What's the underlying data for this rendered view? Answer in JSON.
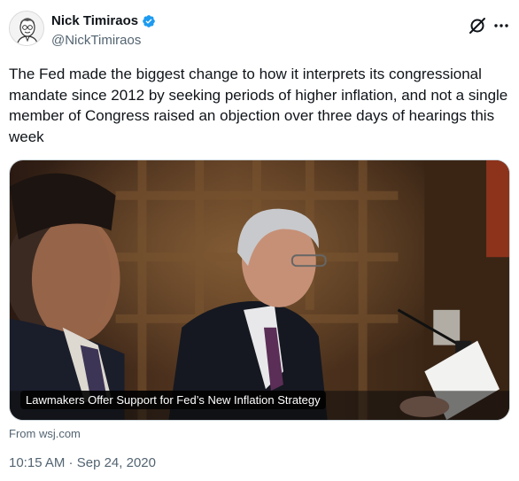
{
  "author": {
    "display_name": "Nick Timiraos",
    "handle": "@NickTimiraos",
    "verified": true
  },
  "tweet": {
    "text": "The Fed made the biggest change to how it interprets its congressional mandate since 2012 by seeking periods of higher inflation, and not a single member of Congress raised an objection over three days of hearings this week"
  },
  "card": {
    "title": "Lawmakers Offer Support for Fed’s New Inflation Strategy",
    "source": "From wsj.com"
  },
  "meta": {
    "time": "10:15 AM",
    "separator": " · ",
    "date": "Sep 24, 2020"
  },
  "icons": {
    "verified": "verified-badge-icon",
    "grok": "grok-icon",
    "more": "more-options-icon"
  },
  "colors": {
    "verified": "#1d9bf0",
    "text": "#0f1419",
    "secondary": "#536471"
  }
}
